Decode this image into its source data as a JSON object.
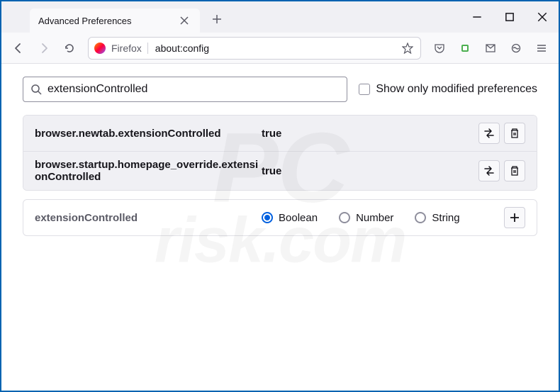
{
  "titlebar": {
    "tab_title": "Advanced Preferences"
  },
  "toolbar": {
    "identity_label": "Firefox",
    "url": "about:config"
  },
  "search": {
    "value": "extensionControlled",
    "checkbox_label": "Show only modified preferences"
  },
  "results": [
    {
      "name": "browser.newtab.extensionControlled",
      "value": "true"
    },
    {
      "name": "browser.startup.homepage_override.extensionControlled",
      "value": "true"
    }
  ],
  "add_row": {
    "name": "extensionControlled",
    "types": [
      "Boolean",
      "Number",
      "String"
    ],
    "selected": "Boolean"
  }
}
